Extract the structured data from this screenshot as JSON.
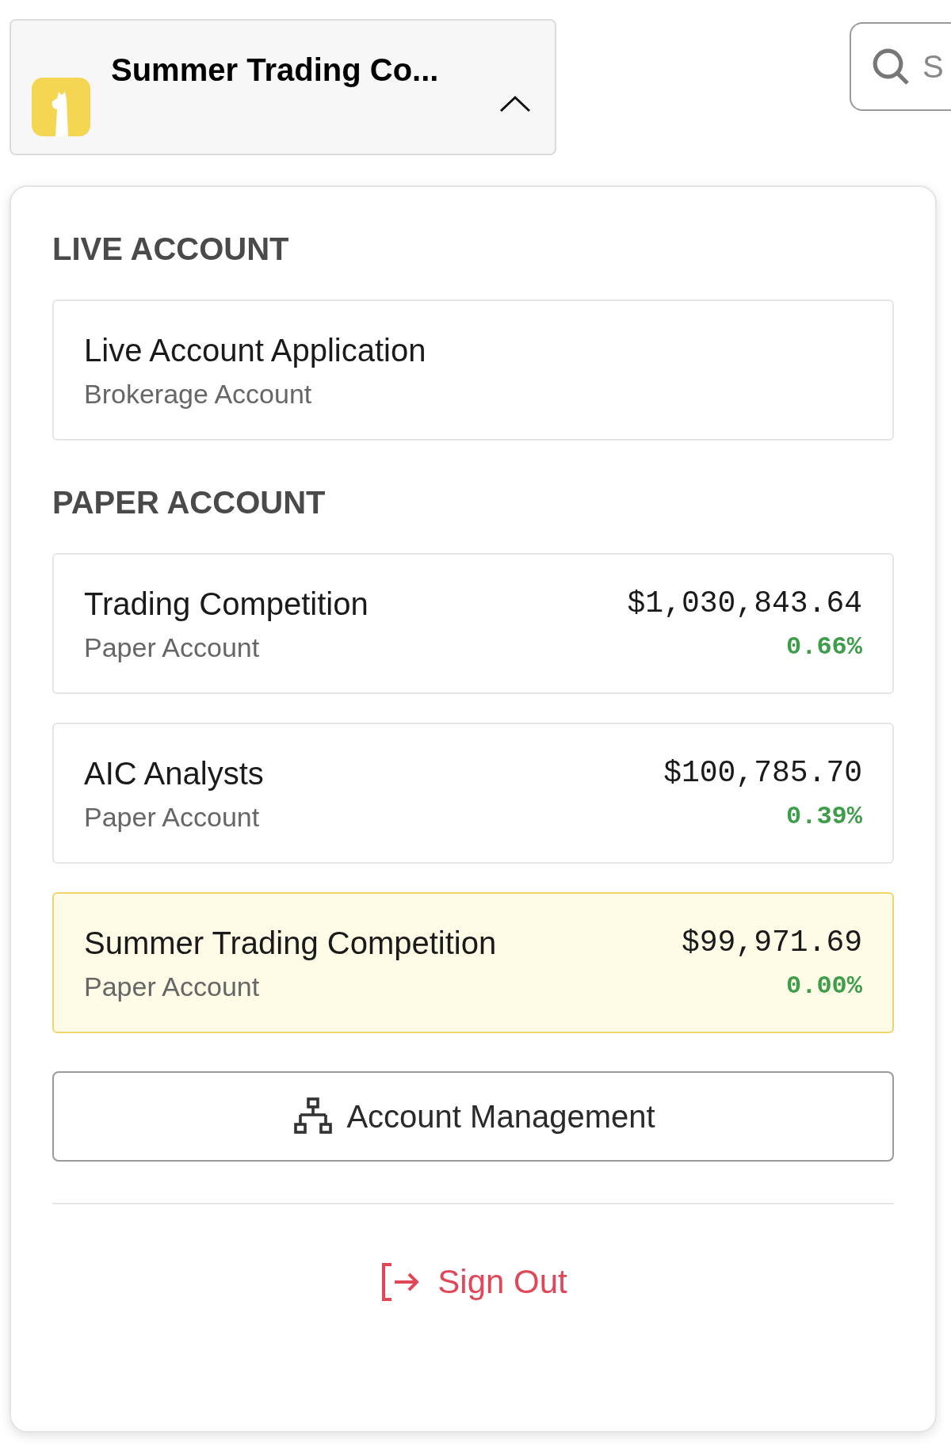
{
  "account_switcher": {
    "title": "Summer Trading Co...",
    "expanded": true
  },
  "search": {
    "placeholder": "S"
  },
  "menu": {
    "sections": [
      {
        "heading": "LIVE ACCOUNT",
        "accounts": [
          {
            "name": "Live Account Application",
            "type": "Brokerage Account",
            "selected": false
          }
        ]
      },
      {
        "heading": "PAPER ACCOUNT",
        "accounts": [
          {
            "name": "Trading Competition",
            "type": "Paper Account",
            "balance": "$1,030,843.64",
            "change": "0.66%",
            "selected": false
          },
          {
            "name": "AIC Analysts",
            "type": "Paper Account",
            "balance": "$100,785.70",
            "change": "0.39%",
            "selected": false
          },
          {
            "name": "Summer Trading Competition",
            "type": "Paper Account",
            "balance": "$99,971.69",
            "change": "0.00%",
            "selected": true
          }
        ]
      }
    ],
    "management_button": "Account Management",
    "sign_out": "Sign Out"
  }
}
